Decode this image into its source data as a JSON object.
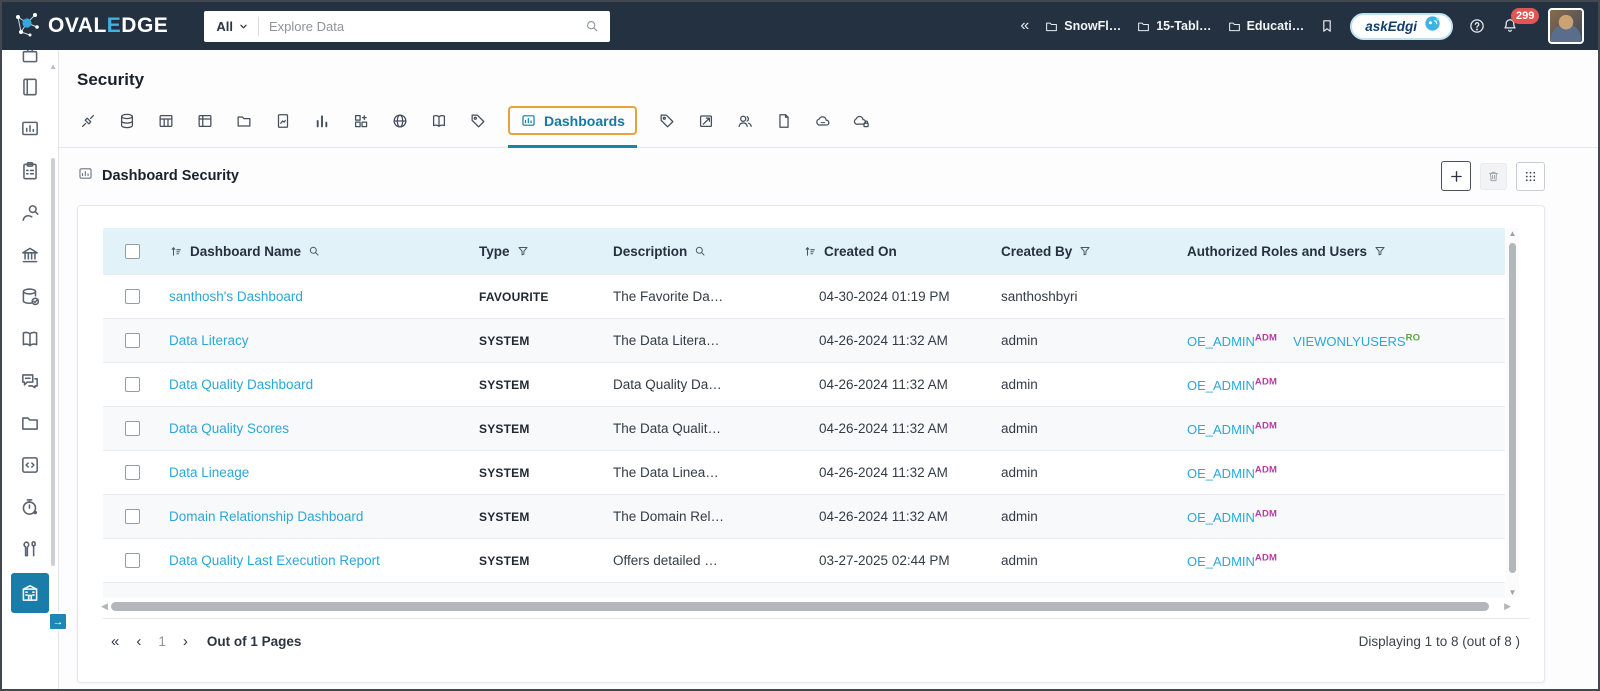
{
  "topbar": {
    "logo": {
      "part1": "OVAL",
      "part2": "E",
      "part3": "DGE"
    },
    "search": {
      "scope": "All",
      "placeholder": "Explore Data"
    },
    "shortcuts": [
      {
        "icon": "folder",
        "label": "SnowFl…"
      },
      {
        "icon": "folder",
        "label": "15-Tabl…"
      },
      {
        "icon": "folder",
        "label": "Educati…"
      }
    ],
    "ask_edgi_label": "askEdgi",
    "notification_count": "299"
  },
  "sidebar": {
    "items": [
      {
        "icon": "briefcase",
        "partial": true
      },
      {
        "icon": "journal"
      },
      {
        "icon": "report"
      },
      {
        "icon": "clipboard"
      },
      {
        "icon": "inspect"
      },
      {
        "icon": "bank"
      },
      {
        "icon": "database-check"
      },
      {
        "icon": "book"
      },
      {
        "icon": "chat"
      },
      {
        "icon": "folder"
      },
      {
        "icon": "code"
      },
      {
        "icon": "timer"
      },
      {
        "icon": "tools"
      },
      {
        "icon": "building",
        "active": true
      }
    ]
  },
  "page": {
    "title": "Security",
    "section_title": "Dashboard Security",
    "tabs": [
      {
        "icon": "connectors"
      },
      {
        "icon": "database"
      },
      {
        "icon": "table"
      },
      {
        "icon": "table-columns"
      },
      {
        "icon": "folder"
      },
      {
        "icon": "file-chart"
      },
      {
        "icon": "bar-chart"
      },
      {
        "icon": "blocks"
      },
      {
        "icon": "globe"
      },
      {
        "icon": "book"
      },
      {
        "icon": "tag"
      },
      {
        "icon": "dashboards",
        "label": "Dashboards",
        "active": true
      },
      {
        "icon": "tag"
      },
      {
        "icon": "launch"
      },
      {
        "icon": "users"
      },
      {
        "icon": "file"
      },
      {
        "icon": "cloud-api"
      },
      {
        "icon": "cloud-api-lock"
      }
    ]
  },
  "table": {
    "columns": [
      {
        "key": "name",
        "label": "Dashboard Name",
        "sort": true,
        "search": true
      },
      {
        "key": "type",
        "label": "Type",
        "filter": true
      },
      {
        "key": "description",
        "label": "Description",
        "search": true
      },
      {
        "key": "created_on",
        "label": "Created On",
        "sort": true
      },
      {
        "key": "created_by",
        "label": "Created By",
        "filter": true
      },
      {
        "key": "roles",
        "label": "Authorized Roles and Users",
        "filter": true
      }
    ],
    "rows": [
      {
        "name": "santhosh's Dashboard",
        "type": "FAVOURITE",
        "description": "The Favorite Da…",
        "created_on": "04-30-2024 01:19 PM",
        "created_by": "santhoshbyri",
        "roles": []
      },
      {
        "name": "Data Literacy",
        "type": "SYSTEM",
        "description": "The Data Litera…",
        "created_on": "04-26-2024 11:32 AM",
        "created_by": "admin",
        "roles": [
          {
            "name": "OE_ADMIN",
            "badge": "ADM",
            "badge_color": "#b53da5"
          },
          {
            "name": "VIEWONLYUSERS",
            "badge": "RO",
            "badge_color": "#58a83a"
          }
        ]
      },
      {
        "name": "Data Quality Dashboard",
        "type": "SYSTEM",
        "description": "Data Quality Da…",
        "created_on": "04-26-2024 11:32 AM",
        "created_by": "admin",
        "roles": [
          {
            "name": "OE_ADMIN",
            "badge": "ADM",
            "badge_color": "#b53da5"
          }
        ]
      },
      {
        "name": "Data Quality Scores",
        "type": "SYSTEM",
        "description": "The Data Qualit…",
        "created_on": "04-26-2024 11:32 AM",
        "created_by": "admin",
        "roles": [
          {
            "name": "OE_ADMIN",
            "badge": "ADM",
            "badge_color": "#b53da5"
          }
        ]
      },
      {
        "name": "Data Lineage",
        "type": "SYSTEM",
        "description": "The Data Linea…",
        "created_on": "04-26-2024 11:32 AM",
        "created_by": "admin",
        "roles": [
          {
            "name": "OE_ADMIN",
            "badge": "ADM",
            "badge_color": "#b53da5"
          }
        ]
      },
      {
        "name": "Domain Relationship Dashboard",
        "type": "SYSTEM",
        "description": "The Domain Rel…",
        "created_on": "04-26-2024 11:32 AM",
        "created_by": "admin",
        "roles": [
          {
            "name": "OE_ADMIN",
            "badge": "ADM",
            "badge_color": "#b53da5"
          }
        ]
      },
      {
        "name": "Data Quality Last Execution Report",
        "type": "SYSTEM",
        "description": "Offers detailed …",
        "created_on": "03-27-2025 02:44 PM",
        "created_by": "admin",
        "roles": [
          {
            "name": "OE_ADMIN",
            "badge": "ADM",
            "badge_color": "#b53da5"
          }
        ]
      }
    ]
  },
  "footer": {
    "page": "1",
    "pages_label": "Out of 1 Pages",
    "displaying": "Displaying 1 to 8  (out of 8 )"
  },
  "colors": {
    "topbar_bg": "#243140",
    "accent_teal": "#1a7ca8",
    "link": "#2ba7d9",
    "active_tab_border": "#e8a13c",
    "badge_red": "#e25555",
    "header_bg": "#e1f2f8"
  }
}
